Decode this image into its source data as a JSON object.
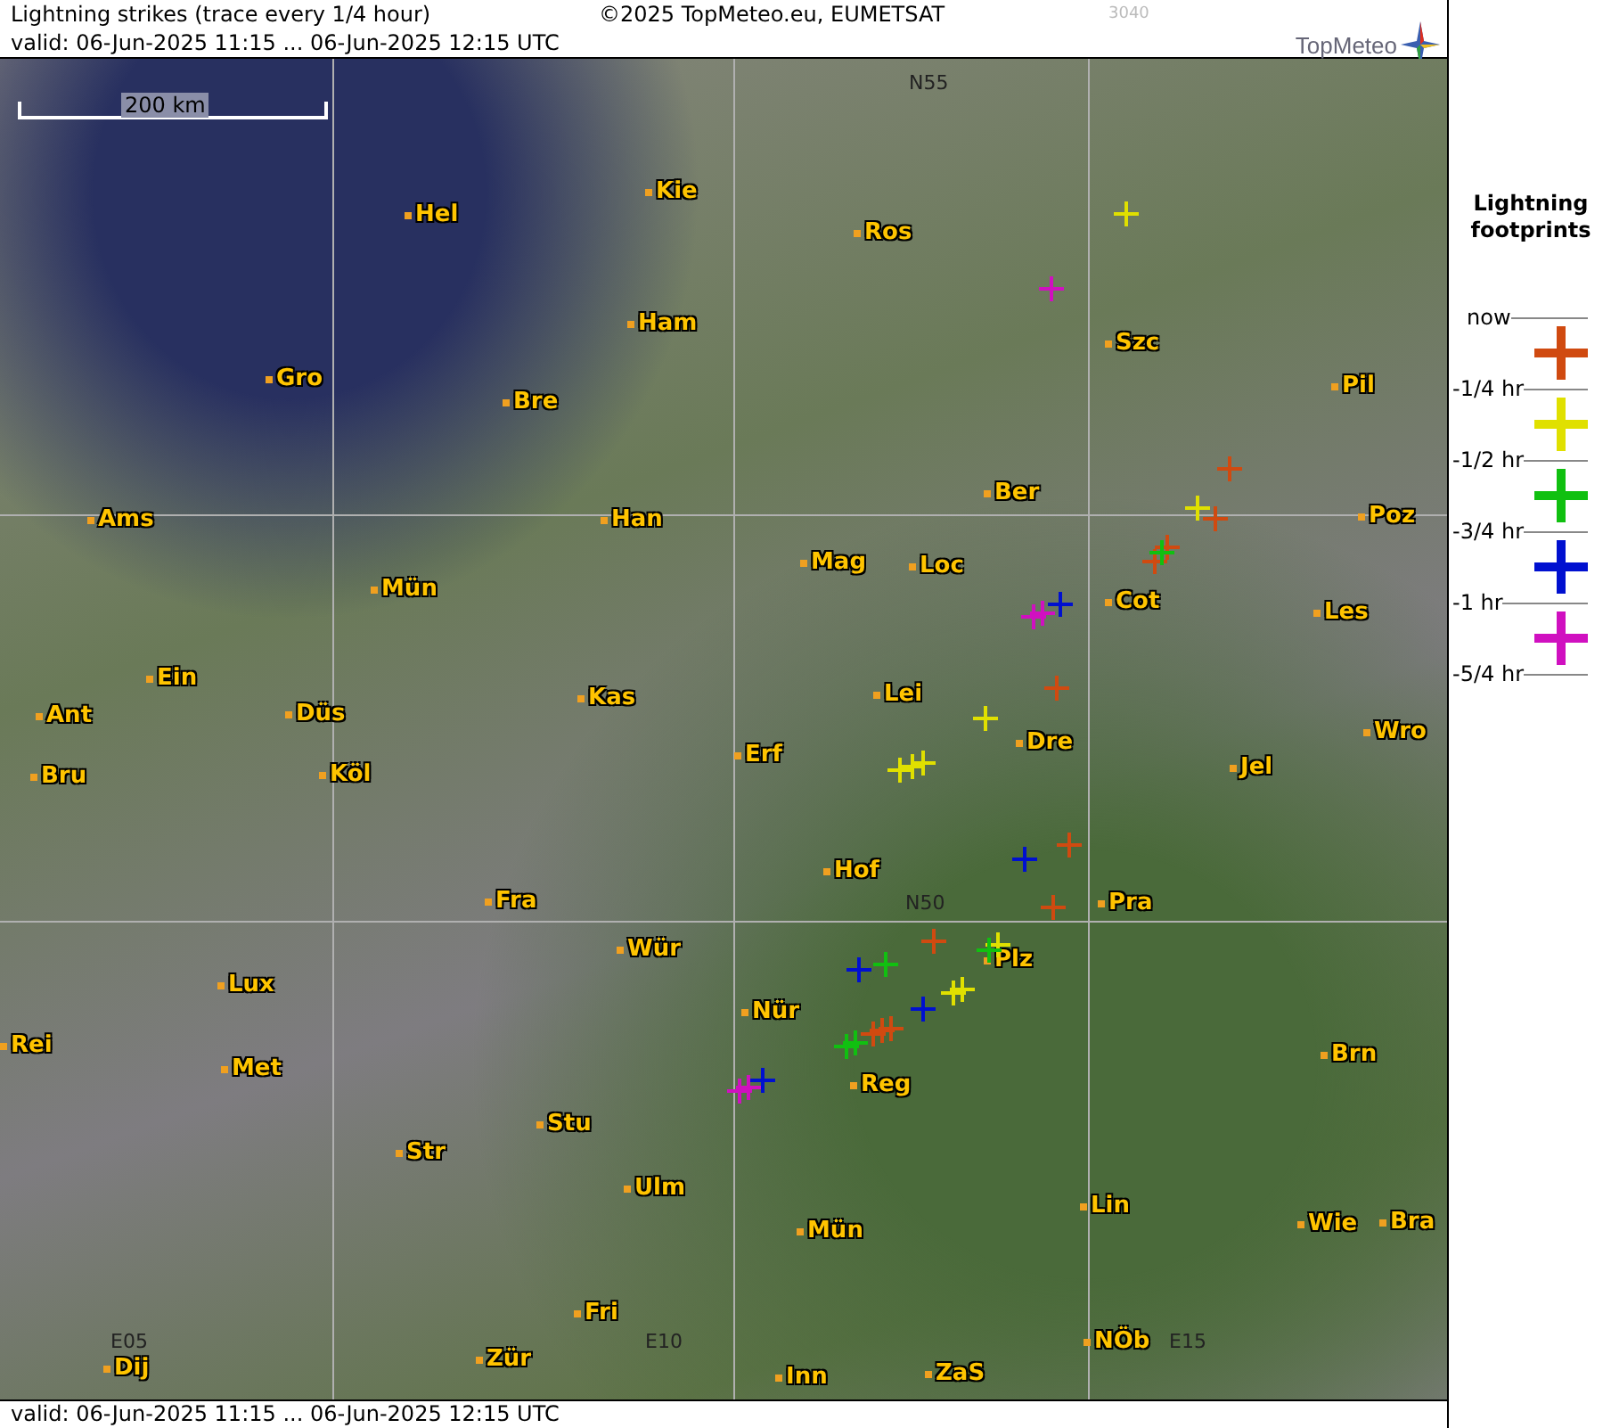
{
  "header": {
    "title": "Lightning strikes (trace every 1/4 hour)",
    "copyright": "©2025 TopMeteo.eu, EUMETSAT",
    "code": "3040",
    "valid": "valid:  06-Jun-2025 11:15 ... 06-Jun-2025 12:15 UTC",
    "logo": "TopMeteo"
  },
  "map": {
    "scale": "200 km",
    "grid_labels": [
      "N55",
      "N50",
      "E05",
      "E10",
      "E15"
    ],
    "cities": [
      "Hel",
      "Kie",
      "Ros",
      "Ham",
      "Szc",
      "Gro",
      "Bre",
      "Pil",
      "Ber",
      "Ams",
      "Han",
      "Poz",
      "Mag",
      "Loc",
      "Mün",
      "Cot",
      "Les",
      "Ein",
      "Kas",
      "Lei",
      "Ant",
      "Düs",
      "Wro",
      "Bru",
      "Köl",
      "Erf",
      "Dre",
      "Jel",
      "Hof",
      "Fra",
      "Pra",
      "Wür",
      "Plz",
      "Lux",
      "Nür",
      "Rei",
      "Met",
      "Reg",
      "Brn",
      "Stu",
      "Str",
      "Ulm",
      "Lin",
      "Mün",
      "Wie",
      "Bra",
      "Fri",
      "NÖb",
      "Dij",
      "Zür",
      "Inn",
      "ZaS"
    ],
    "strikes": [
      {
        "color": "#d010c0"
      },
      {
        "color": "#d010c0"
      },
      {
        "color": "#d010c0"
      },
      {
        "color": "#d010c0"
      },
      {
        "color": "#d010c0"
      },
      {
        "color": "#e0e000"
      },
      {
        "color": "#e0e000"
      },
      {
        "color": "#e0e000"
      },
      {
        "color": "#e0e000"
      },
      {
        "color": "#e0e000"
      },
      {
        "color": "#e0e000"
      },
      {
        "color": "#e0e000"
      },
      {
        "color": "#e0e000"
      },
      {
        "color": "#e0e000"
      },
      {
        "color": "#d04a10"
      },
      {
        "color": "#d04a10"
      },
      {
        "color": "#d04a10"
      },
      {
        "color": "#d04a10"
      },
      {
        "color": "#d04a10"
      },
      {
        "color": "#d04a10"
      },
      {
        "color": "#d04a10"
      },
      {
        "color": "#d04a10"
      },
      {
        "color": "#d04a10"
      },
      {
        "color": "#d04a10"
      },
      {
        "color": "#d04a10"
      },
      {
        "color": "#10c010"
      },
      {
        "color": "#10c010"
      },
      {
        "color": "#10c010"
      },
      {
        "color": "#10c010"
      },
      {
        "color": "#10c010"
      },
      {
        "color": "#0010d0"
      },
      {
        "color": "#0010d0"
      },
      {
        "color": "#0010d0"
      },
      {
        "color": "#0010d0"
      },
      {
        "color": "#0010d0"
      }
    ]
  },
  "legend": {
    "title": "Lightning footprints",
    "labels": [
      "now",
      "-1/4 hr",
      "-1/2 hr",
      "-3/4 hr",
      "-1 hr",
      "-5/4 hr"
    ],
    "entries": [
      {
        "color": "#d04a10"
      },
      {
        "color": "#e0e000"
      },
      {
        "color": "#10c010"
      },
      {
        "color": "#0010d0"
      },
      {
        "color": "#d010c0"
      }
    ]
  },
  "footer": {
    "valid": "valid:  06-Jun-2025 11:15 ... 06-Jun-2025 12:15 UTC"
  }
}
